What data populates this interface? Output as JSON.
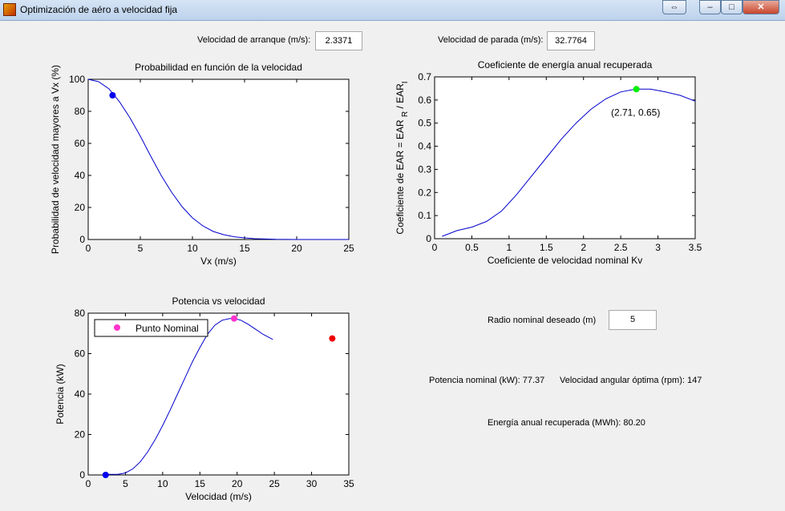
{
  "window": {
    "title": "Optimización de aéro a velocidad fija",
    "restore_glyph": "⇔",
    "minimize_glyph": "–",
    "maximize_glyph": "□",
    "close_glyph": "✕"
  },
  "controls": {
    "start_speed_label": "Velocidad de arranque (m/s):",
    "start_speed_value": "2.3371",
    "stop_speed_label": "Velocidad de parada (m/s):",
    "stop_speed_value": "32.7764",
    "radius_label": "Radio nominal deseado (m)",
    "radius_value": "5"
  },
  "results": {
    "power_text": "Potencia nominal (kW): 77.37",
    "angular_text": "Velocidad angular óptima (rpm): 147",
    "energy_text": "Energía anual recuperada (MWh): 80.20"
  },
  "chart_data": [
    {
      "type": "line",
      "title": "Probabilidad en función de la velocidad",
      "xlabel": "Vx (m/s)",
      "ylabel": "Probabilidad de velocidad mayores a Vx (%)",
      "xlim": [
        0,
        25
      ],
      "ylim": [
        0,
        100
      ],
      "xticks": [
        0,
        5,
        10,
        15,
        20,
        25
      ],
      "yticks": [
        0,
        20,
        40,
        60,
        80,
        100
      ],
      "series": [
        {
          "color": "#0000cc",
          "x": [
            0,
            1,
            2,
            3,
            4,
            5,
            6,
            7,
            8,
            9,
            10,
            11,
            12,
            13,
            14,
            15,
            16,
            17,
            18,
            20,
            22,
            25
          ],
          "y": [
            100,
            98.5,
            94,
            86,
            76,
            64.5,
            52,
            40,
            29.5,
            20.5,
            13.5,
            8.5,
            5,
            3,
            1.7,
            1,
            0.5,
            0.3,
            0.1,
            0,
            0,
            0
          ]
        }
      ],
      "points": [
        {
          "x": 2.34,
          "y": 90,
          "color": "#0000ee"
        }
      ]
    },
    {
      "type": "line",
      "title": "Coeficiente de energía anual recuperada",
      "xlabel": "Coeficiente de velocidad nominal Kv",
      "ylabel": "Coeficiente de EAR = EAR",
      "ylabel_sub": "R",
      "ylabel_tail": "/ EAR",
      "ylabel_sub2": "I",
      "xlim": [
        0,
        3.5
      ],
      "ylim": [
        0,
        0.7
      ],
      "xticks": [
        0,
        0.5,
        1,
        1.5,
        2,
        2.5,
        3,
        3.5
      ],
      "yticks": [
        0,
        0.1,
        0.2,
        0.3,
        0.4,
        0.5,
        0.6,
        0.7
      ],
      "series": [
        {
          "color": "#0000cc",
          "x": [
            0.1,
            0.3,
            0.5,
            0.7,
            0.9,
            1.1,
            1.3,
            1.5,
            1.7,
            1.9,
            2.1,
            2.3,
            2.5,
            2.7,
            2.9,
            3.1,
            3.3,
            3.5
          ],
          "y": [
            0.01,
            0.035,
            0.05,
            0.075,
            0.12,
            0.19,
            0.27,
            0.35,
            0.43,
            0.5,
            0.56,
            0.605,
            0.635,
            0.647,
            0.647,
            0.635,
            0.62,
            0.595
          ]
        }
      ],
      "points": [
        {
          "x": 2.71,
          "y": 0.647,
          "color": "#00ee00"
        }
      ],
      "annotation": {
        "text": "(2.71, 0.65)",
        "x": 2.71,
        "y": 0.647
      }
    },
    {
      "type": "line",
      "title": "Potencia vs velocidad",
      "xlabel": "Velocidad (m/s)",
      "ylabel": "Potencia (kW)",
      "xlim": [
        0,
        35
      ],
      "ylim": [
        0,
        80
      ],
      "xticks": [
        0,
        5,
        10,
        15,
        20,
        25,
        30,
        35
      ],
      "yticks": [
        0,
        20,
        40,
        60,
        80
      ],
      "legend": {
        "label": "Punto Nominal",
        "marker_color": "#ff33cc",
        "placement": "top-left"
      },
      "series": [
        {
          "color": "#0000cc",
          "x": [
            2.34,
            3,
            4,
            5,
            6,
            7,
            8,
            9,
            10,
            11,
            12,
            13,
            14,
            15,
            16,
            17,
            18,
            19,
            19.6,
            20.5,
            21.5,
            22.5,
            23.5,
            24.8
          ],
          "y": [
            0.3,
            0.3,
            0.3,
            1,
            3,
            6.5,
            11.5,
            17.5,
            24.5,
            32,
            40,
            48,
            56,
            63,
            69.5,
            74,
            76.5,
            77.3,
            77.4,
            76.5,
            74.5,
            72,
            69.5,
            67
          ]
        }
      ],
      "points": [
        {
          "x": 2.34,
          "y": 0,
          "color": "#0000ee"
        },
        {
          "x": 19.6,
          "y": 77.37,
          "color": "#ff33cc"
        },
        {
          "x": 32.78,
          "y": 67.5,
          "color": "#ee0000"
        }
      ]
    }
  ]
}
